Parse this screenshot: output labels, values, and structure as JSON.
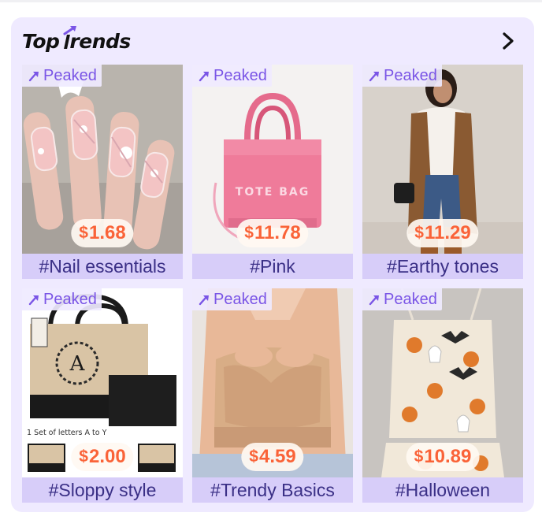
{
  "header": {
    "title_part1": "Top",
    "title_part2": "rends",
    "title_full": "Top Trends",
    "arrow_icon": "chevron-right-icon"
  },
  "colors": {
    "panel_bg": "#efeaff",
    "badge_text": "#7a55e6",
    "price_text": "#fa6338",
    "tag_bg": "#d7cdf9",
    "tag_text": "#3a2f86"
  },
  "cards": [
    {
      "badge": "Peaked",
      "currency": "$",
      "price": "1.68",
      "tag": "#Nail essentials",
      "image": "nails"
    },
    {
      "badge": "Peaked",
      "currency": "$",
      "price": "11.78",
      "tag": "#Pink",
      "image": "pink-tote-bag"
    },
    {
      "badge": "Peaked",
      "currency": "$",
      "price": "11.29",
      "tag": "#Earthy tones",
      "image": "earthy-outfit"
    },
    {
      "badge": "Peaked",
      "currency": "$",
      "price": "2.00",
      "tag": "#Sloppy style",
      "image": "canvas-tote-bags"
    },
    {
      "badge": "Peaked",
      "currency": "$",
      "price": "4.59",
      "tag": "#Trendy Basics",
      "image": "nude-bra"
    },
    {
      "badge": "Peaked",
      "currency": "$",
      "price": "10.89",
      "tag": "#Halloween",
      "image": "halloween-pajamas"
    }
  ],
  "bag_print": {
    "tote_text": "TOTE BAG",
    "letters_note": "1 Set of letters A to Y",
    "monogram": "A"
  }
}
